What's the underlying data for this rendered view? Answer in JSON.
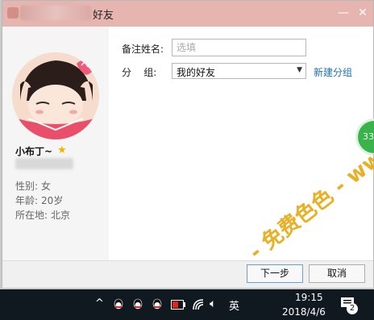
{
  "window": {
    "title_suffix": "好友",
    "min_glyph": "—",
    "close_glyph": "✕"
  },
  "profile": {
    "nickname": "小布丁~",
    "gender_label": "性别:",
    "gender": "女",
    "age_label": "年龄:",
    "age": "20岁",
    "location_label": "所在地:",
    "location": "北京"
  },
  "form": {
    "remark_label": "备注姓名:",
    "remark_placeholder": "选填",
    "group_label": "分    组:",
    "group_value": "我的好友",
    "new_group_link": "新建分组"
  },
  "buttons": {
    "next": "下一步",
    "cancel": "取消"
  },
  "float_badge": "33",
  "watermark": "- 免费色色 - www.MFsese.com",
  "taskbar": {
    "ime": "英",
    "time": "19:15",
    "date": "2018/4/6",
    "notification_count": "2"
  },
  "colors": {
    "titlebar": "#e6b5b0",
    "link": "#1e6fb7",
    "taskbar": "#101820",
    "badge": "#38b44a",
    "watermark": "#e6a200"
  },
  "icons": [
    "qq-icon",
    "star-icon",
    "chevron-up-icon",
    "wifi-icon",
    "volume-icon",
    "notification-icon"
  ]
}
